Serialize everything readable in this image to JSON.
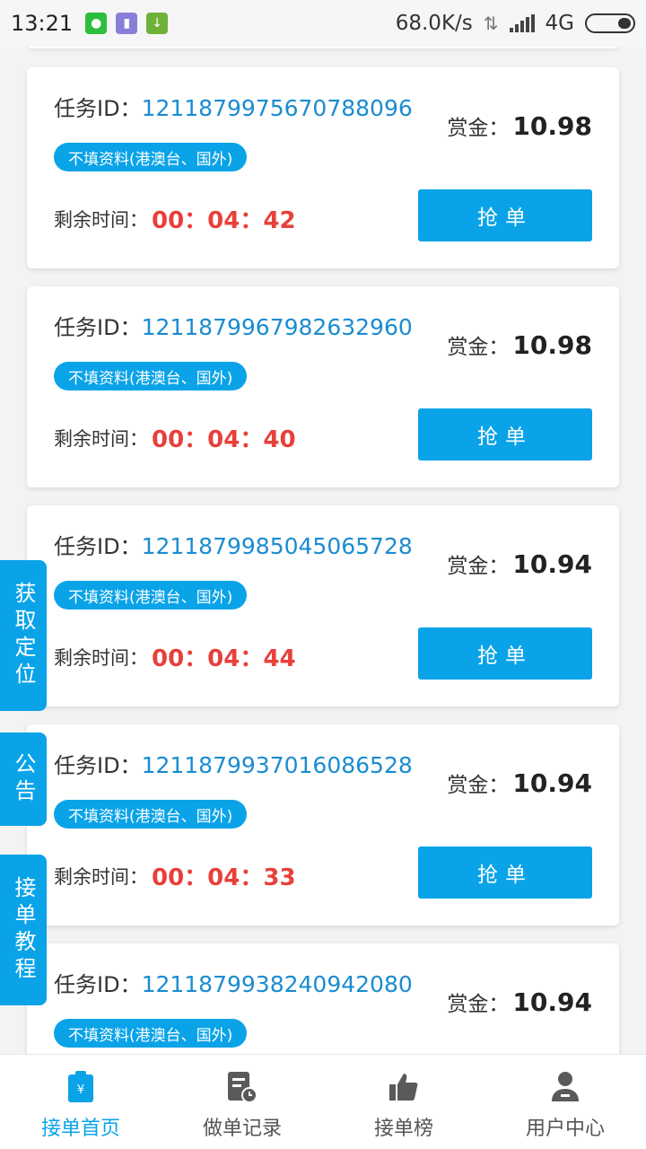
{
  "status_bar": {
    "time": "13:21",
    "network_speed": "68.0K/s",
    "network_type": "4G",
    "icons": [
      "wechat-icon",
      "app-icon",
      "download-icon"
    ]
  },
  "tasks": [
    {
      "id_label": "任务ID：",
      "id": "1211879975670788096",
      "tag": "不填资料(港澳台、国外)",
      "remain_label": "剩余时间：",
      "timer": "00：04：42",
      "reward_label": "赏金：",
      "reward": "10.98",
      "button": "抢单"
    },
    {
      "id_label": "任务ID：",
      "id": "1211879967982632960",
      "tag": "不填资料(港澳台、国外)",
      "remain_label": "剩余时间：",
      "timer": "00：04：40",
      "reward_label": "赏金：",
      "reward": "10.98",
      "button": "抢单"
    },
    {
      "id_label": "任务ID：",
      "id": "1211879985045065728",
      "tag": "不填资料(港澳台、国外)",
      "remain_label": "剩余时间：",
      "timer": "00：04：44",
      "reward_label": "赏金：",
      "reward": "10.94",
      "button": "抢单"
    },
    {
      "id_label": "任务ID：",
      "id": "1211879937016086528",
      "tag": "不填资料(港澳台、国外)",
      "remain_label": "剩余时间：",
      "timer": "00：04：33",
      "reward_label": "赏金：",
      "reward": "10.94",
      "button": "抢单"
    },
    {
      "id_label": "任务ID：",
      "id": "1211879938240942080",
      "tag": "不填资料(港澳台、国外)",
      "reward_label": "赏金：",
      "reward": "10.94"
    }
  ],
  "side_tabs": {
    "location": "获取定位",
    "notice": "公告",
    "tutorial": "接单教程"
  },
  "bottom_nav": [
    {
      "label": "接单首页",
      "icon": "clipboard-yuan-icon",
      "active": true
    },
    {
      "label": "做单记录",
      "icon": "document-clock-icon",
      "active": false
    },
    {
      "label": "接单榜",
      "icon": "thumbs-up-icon",
      "active": false
    },
    {
      "label": "用户中心",
      "icon": "user-icon",
      "active": false
    }
  ],
  "colors": {
    "accent": "#0aa3e8",
    "timer": "#e8403a",
    "id_text": "#1a8cd0"
  }
}
